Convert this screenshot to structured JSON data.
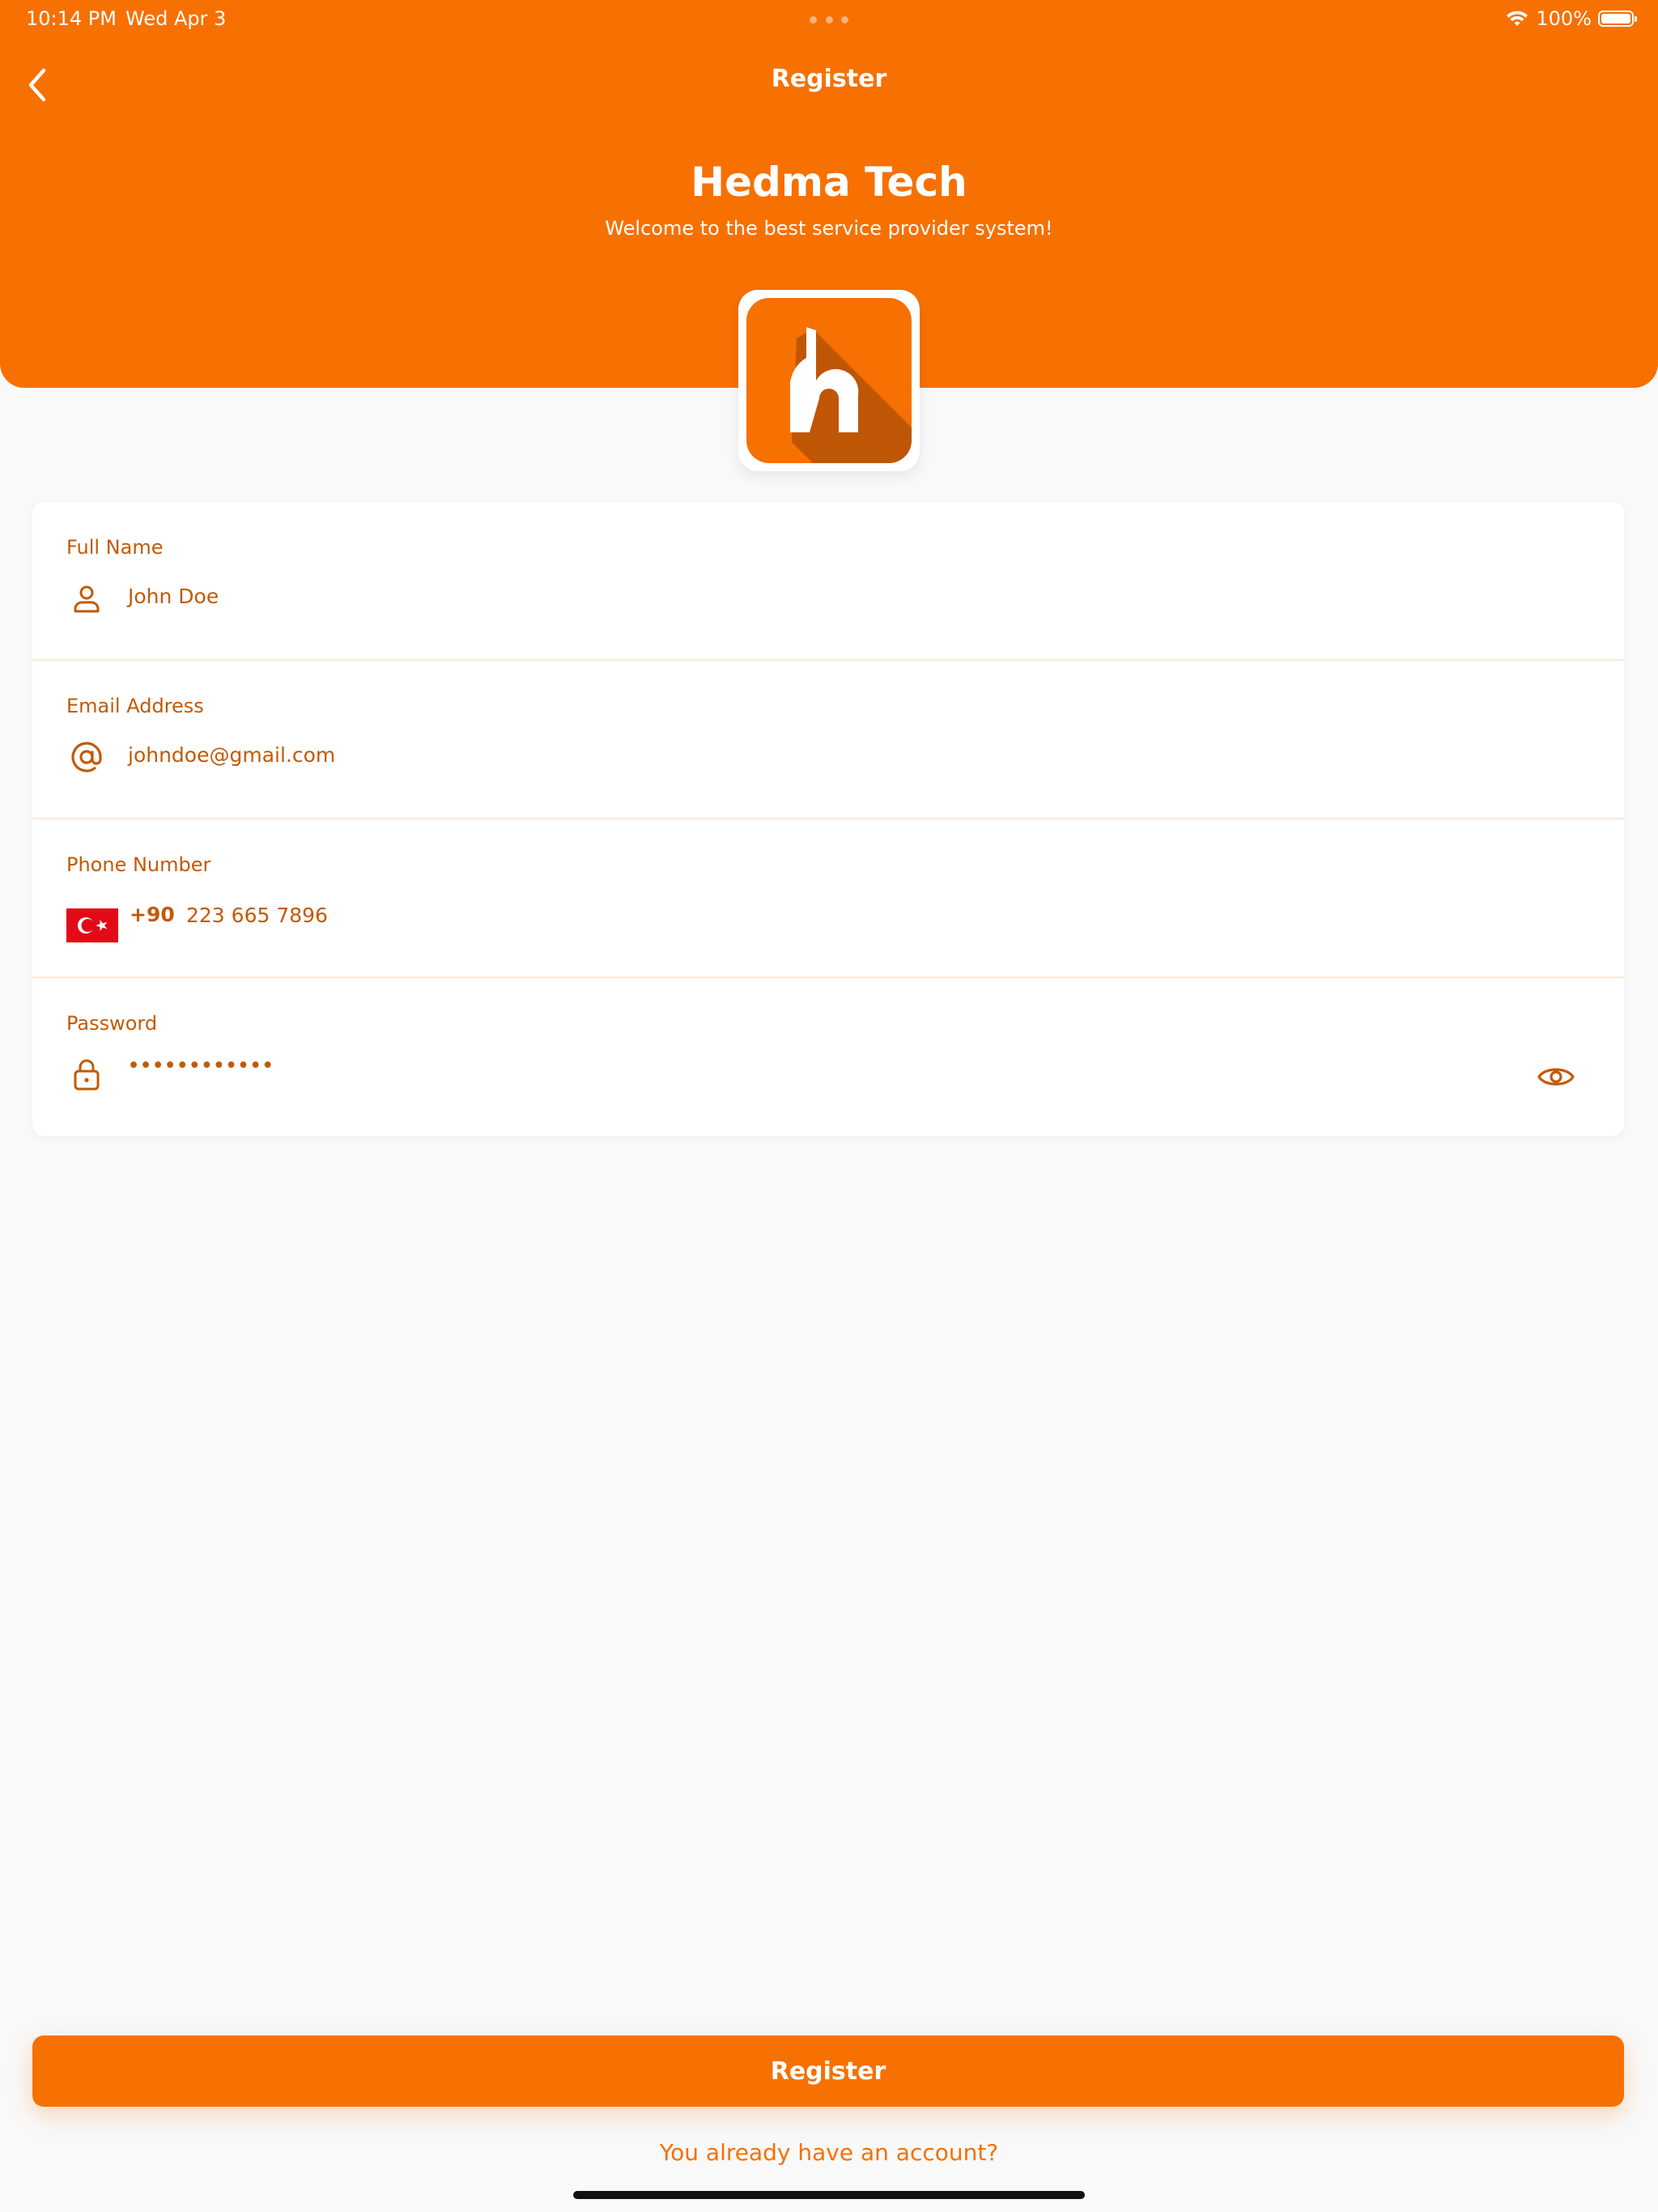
{
  "status_bar": {
    "time": "10:14 PM",
    "date": "Wed Apr 3",
    "battery": "100%",
    "battery_level": 100
  },
  "header": {
    "nav_title": "Register",
    "brand_title": "Hedma Tech",
    "brand_subtitle": "Welcome to the best service provider system!"
  },
  "form": {
    "full_name": {
      "label": "Full Name",
      "value": "John Doe",
      "icon": "user-icon"
    },
    "email": {
      "label": "Email Address",
      "value": "johndoe@gmail.com",
      "icon": "at-icon"
    },
    "phone": {
      "label": "Phone Number",
      "dial_code": "+90",
      "value": "223 665 7896",
      "flag": "turkey-flag-icon"
    },
    "password": {
      "label": "Password",
      "value": "••••••••••••",
      "icon": "lock-icon",
      "toggle_icon": "eye-icon"
    }
  },
  "actions": {
    "register_label": "Register",
    "login_link": "You already have an account?"
  },
  "colors": {
    "primary": "#f77002",
    "primary_dark": "#c25a06",
    "background": "#f9f9f9",
    "card": "#ffffff",
    "divider": "#fbe9da"
  }
}
